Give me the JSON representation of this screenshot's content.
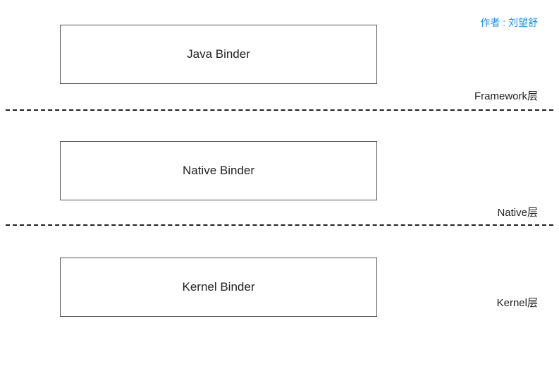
{
  "author": "作者 : 刘望舒",
  "layers": {
    "framework": {
      "box_label": "Java Binder",
      "side_label": "Framework层"
    },
    "native": {
      "box_label": "Native Binder",
      "side_label": "Native层"
    },
    "kernel": {
      "box_label": "Kernel Binder",
      "side_label": "Kernel层"
    }
  }
}
